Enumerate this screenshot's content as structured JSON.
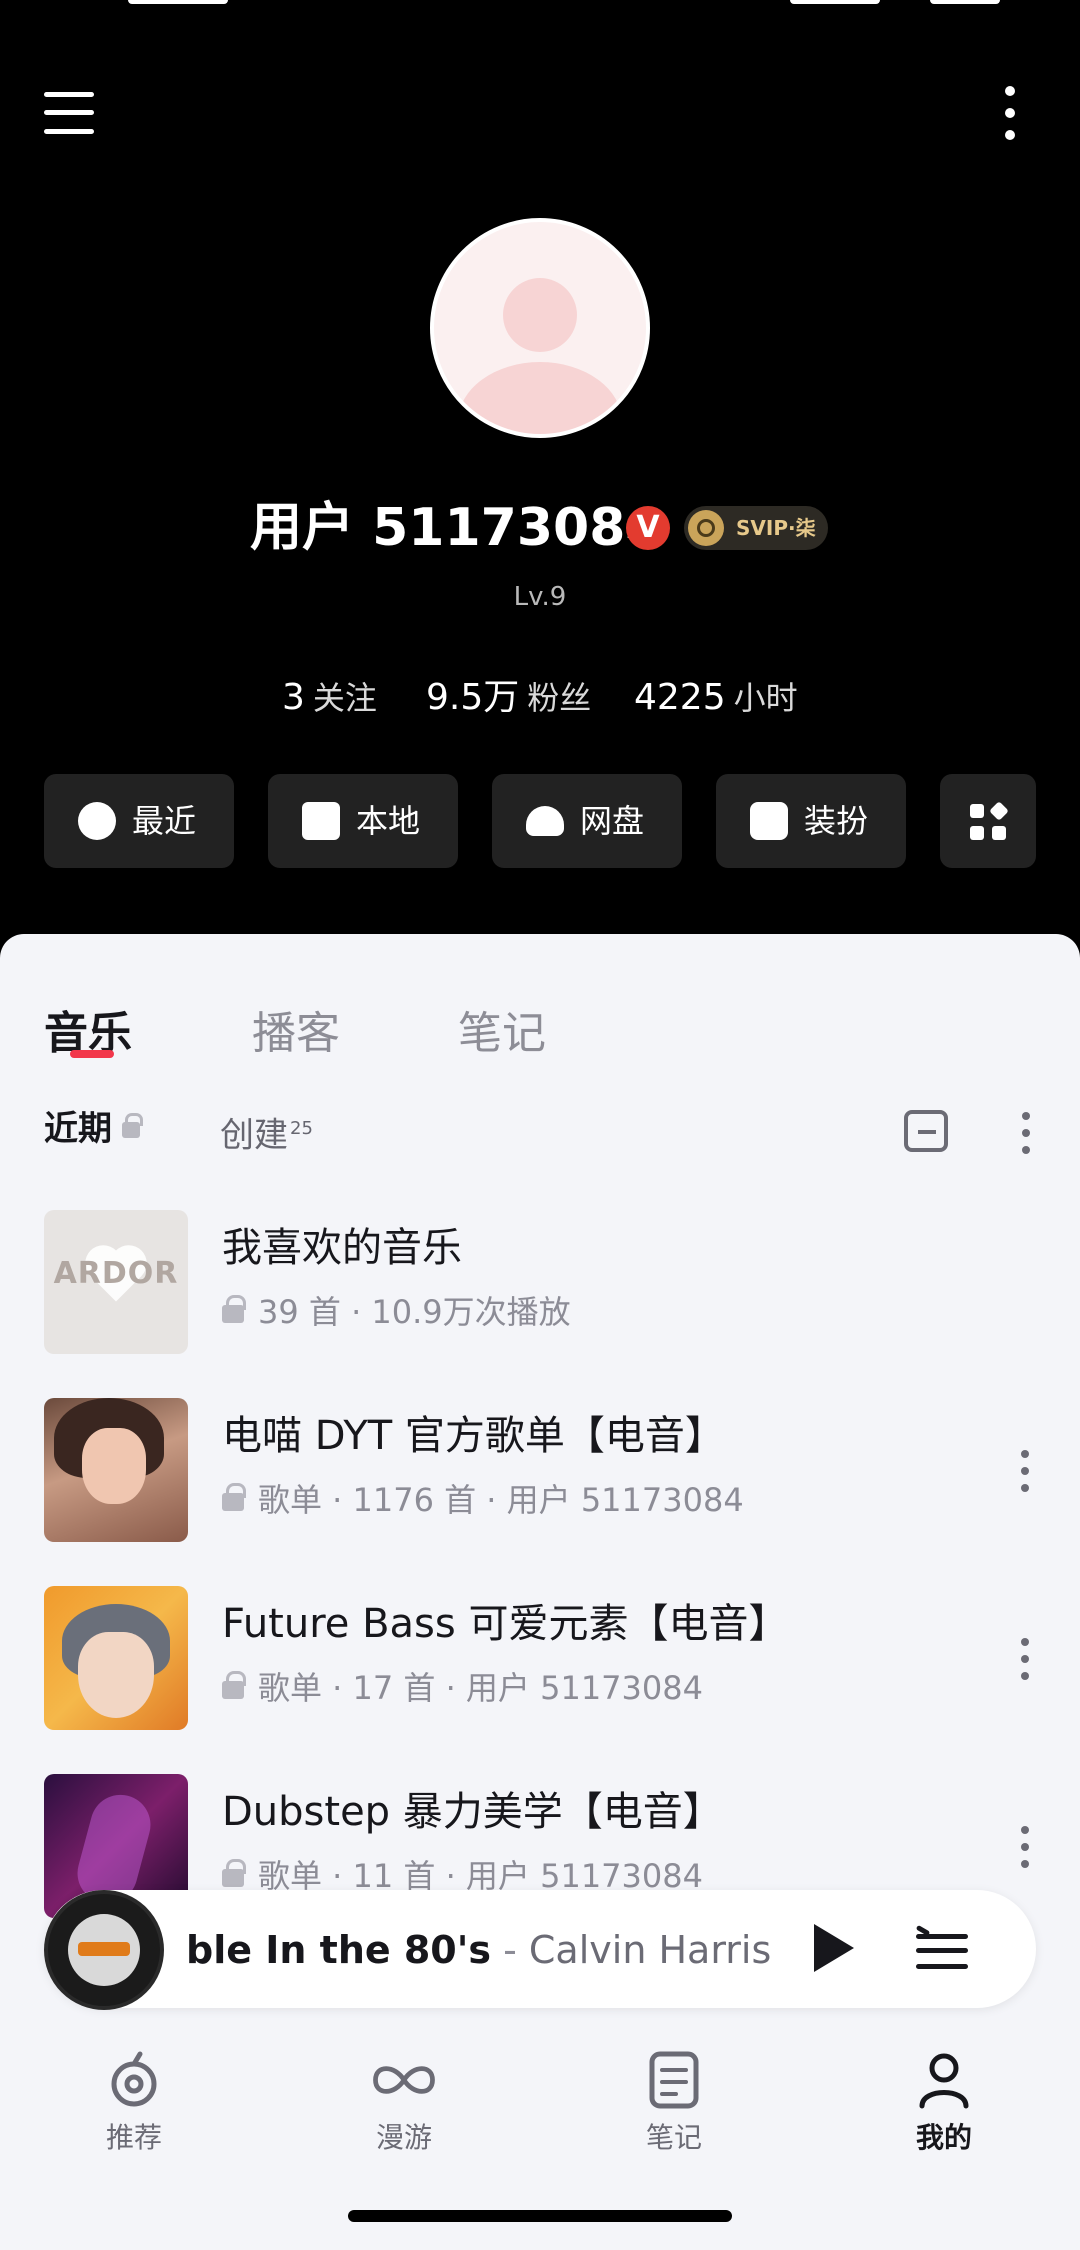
{
  "header": {
    "username": "用户 51173084",
    "vip_badge": "V",
    "svip_label": "SVIP·柒",
    "level": "Lv.9"
  },
  "stats": [
    {
      "value": "3",
      "label": "关注"
    },
    {
      "value": "9.5万",
      "label": "粉丝"
    },
    {
      "value": "4225",
      "label": "小时"
    }
  ],
  "quick_actions": [
    {
      "label": "最近",
      "icon": "clock-icon"
    },
    {
      "label": "本地",
      "icon": "download-box-icon"
    },
    {
      "label": "网盘",
      "icon": "cloud-upload-icon"
    },
    {
      "label": "装扮",
      "icon": "shirt-icon"
    },
    {
      "label": "",
      "icon": "apps-grid-icon"
    }
  ],
  "tabs": [
    {
      "label": "音乐",
      "active": true
    },
    {
      "label": "播客",
      "active": false
    },
    {
      "label": "笔记",
      "active": false
    }
  ],
  "subtabs": {
    "recent": "近期",
    "created": "创建",
    "created_count": "25"
  },
  "playlists": [
    {
      "title": "我喜欢的音乐",
      "sub": "39 首 · 10.9万次播放",
      "cover_text": "ARDOR"
    },
    {
      "title": "电喵 DYT 官方歌单【电音】",
      "sub": "歌单 · 1176 首 · 用户 51173084"
    },
    {
      "title": "Future Bass 可爱元素【电音】",
      "sub": "歌单 · 17 首 · 用户 51173084"
    },
    {
      "title": "Dubstep 暴力美学【电音】",
      "sub": "歌单 · 11 首 · 用户 51173084"
    }
  ],
  "now_playing": {
    "song": "ble In the 80's",
    "separator": " - ",
    "artist": "Calvin Harris"
  },
  "nav": [
    {
      "label": "推荐",
      "icon": "recommend-icon",
      "active": false
    },
    {
      "label": "漫游",
      "icon": "infinity-icon",
      "active": false
    },
    {
      "label": "笔记",
      "icon": "note-icon",
      "active": false
    },
    {
      "label": "我的",
      "icon": "user-icon",
      "active": true
    }
  ],
  "colors": {
    "accent": "#f2374b",
    "background_dark": "#000000",
    "panel": "#f4f5f9"
  }
}
